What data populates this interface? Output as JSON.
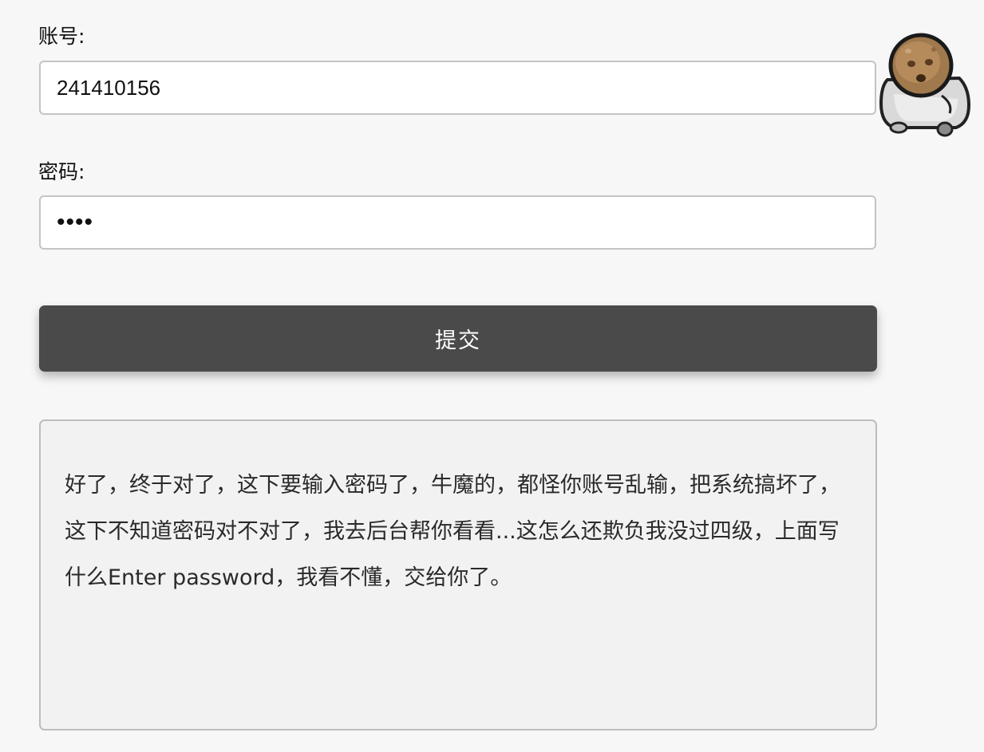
{
  "form": {
    "account_label": "账号:",
    "account_value": "241410156",
    "password_label": "密码:",
    "password_value": "1234",
    "submit_label": "提交"
  },
  "message": {
    "text": "好了，终于对了，这下要输入密码了，牛魔的，都怪你账号乱输，把系统搞坏了，这下不知道密码对不对了，我去后台帮你看看...这怎么还欺负我没过四级，上面写什么Enter password，我看不懂，交给你了。"
  },
  "mascot": {
    "icon": "hamster-mascot-icon"
  },
  "colors": {
    "page_background": "#f7f7f7",
    "button_background": "#4a4a4a",
    "button_text": "#ffffff",
    "message_background": "#f2f2f2"
  }
}
